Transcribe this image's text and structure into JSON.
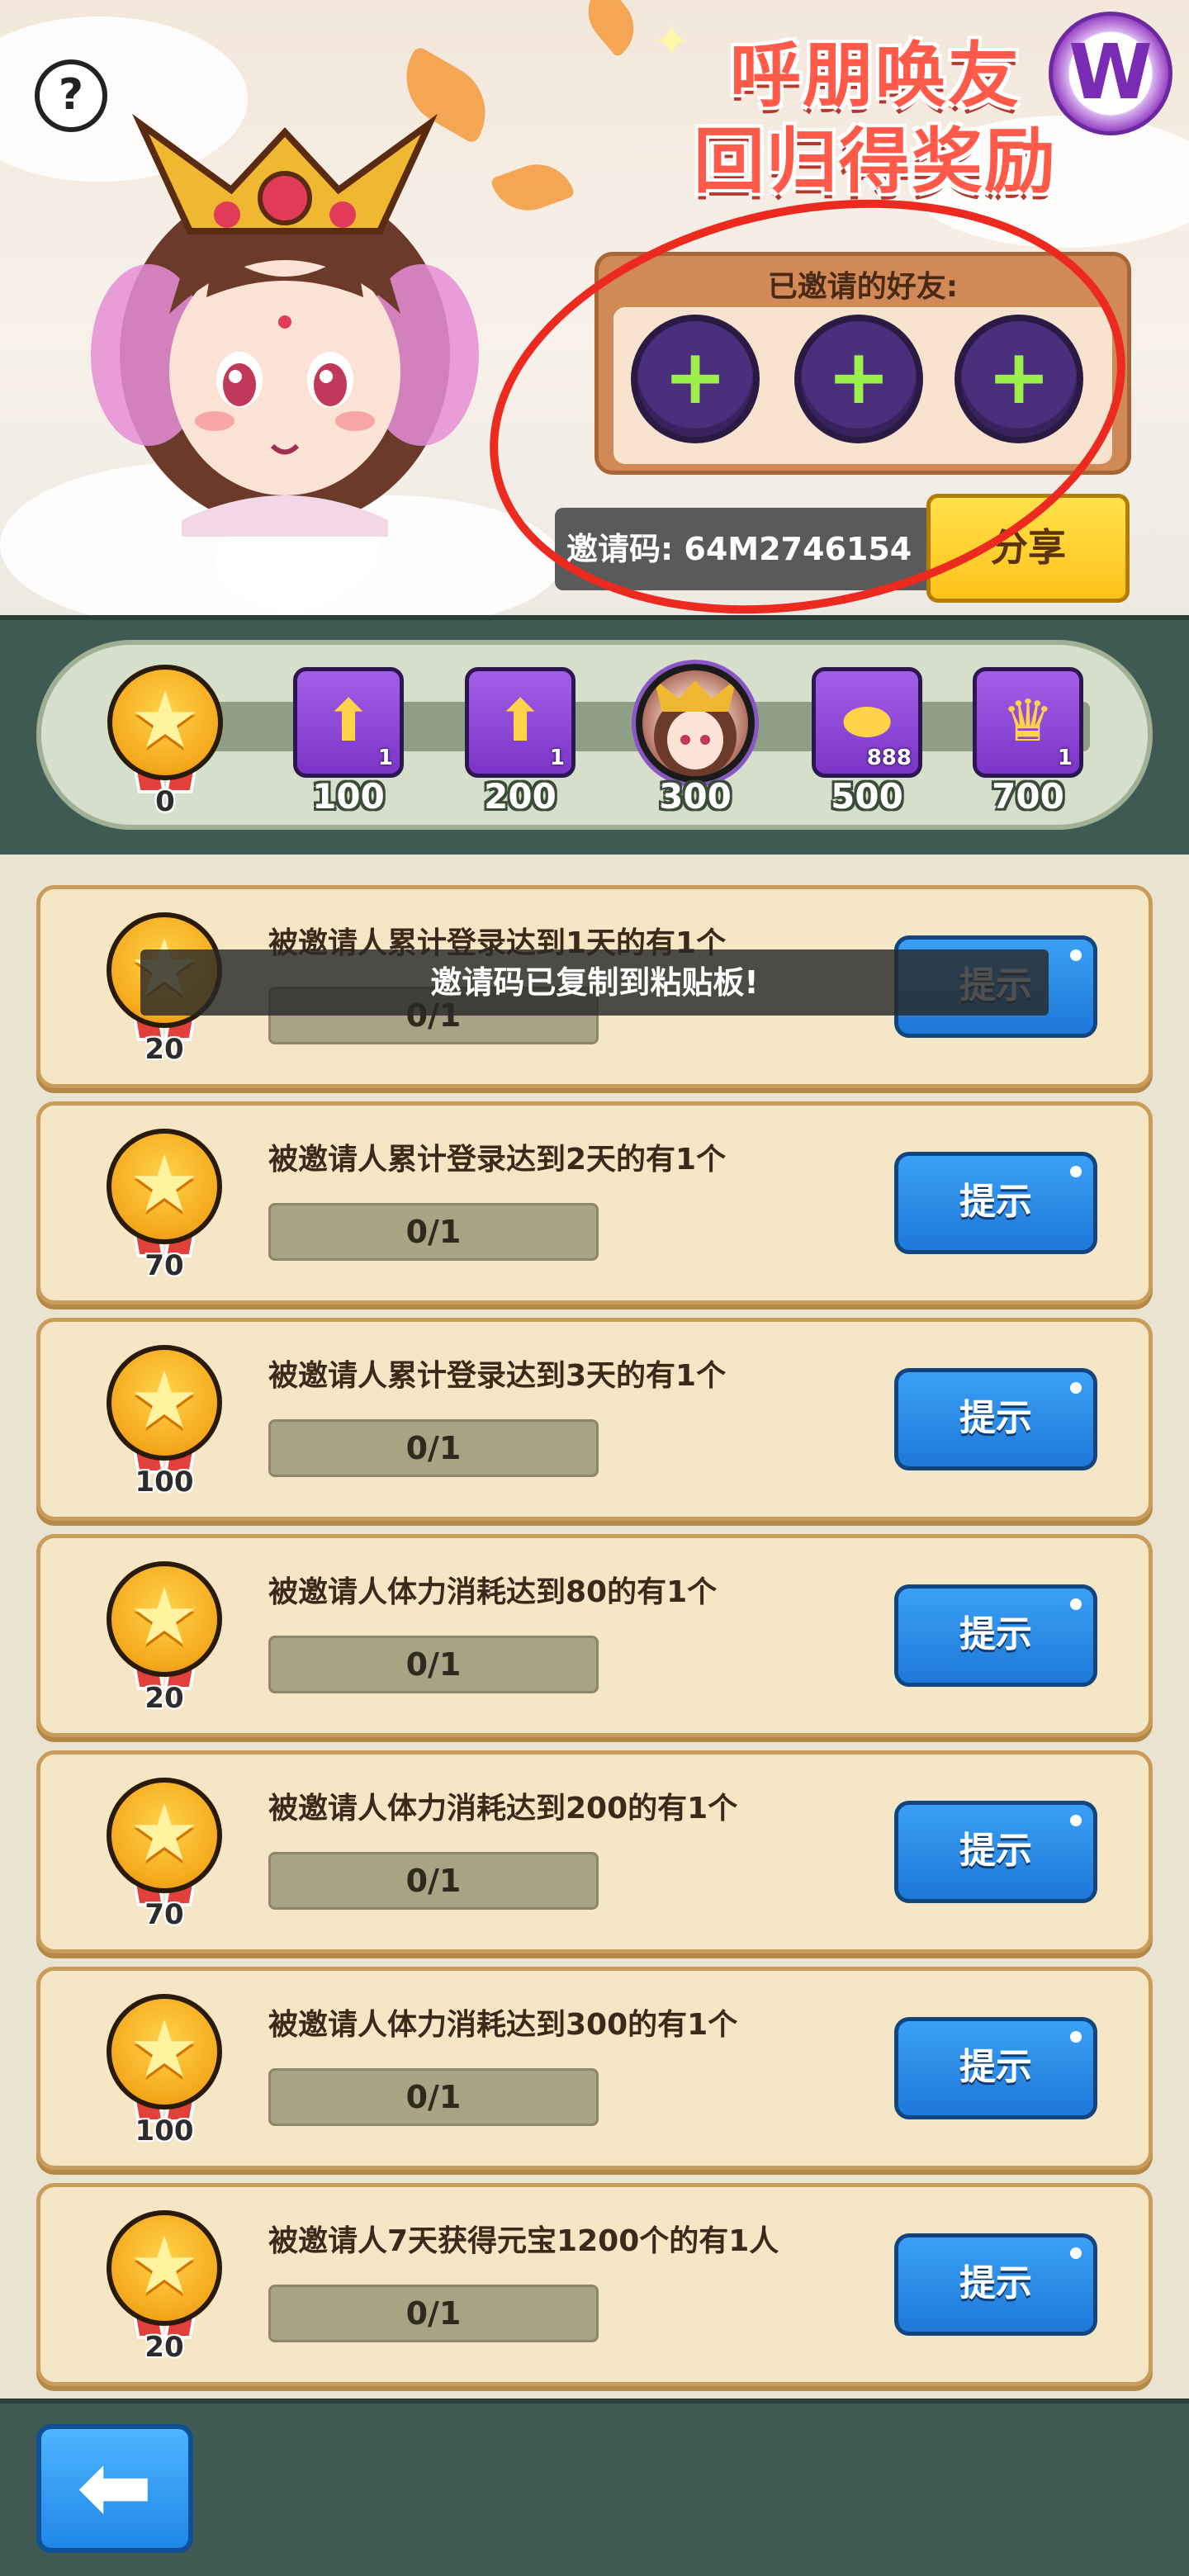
{
  "header": {
    "help_icon": "?",
    "title_line1": "呼朋唤友",
    "title_line2": "回归得奖励",
    "logo_letter": "W",
    "invited_label": "已邀请的好友:",
    "invite_slots": [
      "+",
      "+",
      "+"
    ],
    "invite_code_text": "邀请码: 64M2746154",
    "share_label": "分享"
  },
  "milestones": {
    "current_points": "0",
    "markers": [
      {
        "points": "100",
        "icon": "chest-upgrade-icon",
        "qty": "1"
      },
      {
        "points": "200",
        "icon": "chest-upgrade-icon",
        "qty": "1"
      },
      {
        "points": "300",
        "icon": "hero-avatar-icon",
        "qty": ""
      },
      {
        "points": "500",
        "icon": "gold-ingot-icon",
        "qty": "888"
      },
      {
        "points": "700",
        "icon": "crown-chest-icon",
        "qty": "1"
      }
    ]
  },
  "toast": "邀请码已复制到粘贴板!",
  "tasks": [
    {
      "reward": "20",
      "text": "被邀请人累计登录达到1天的有1个",
      "progress": "0/1",
      "button": "提示"
    },
    {
      "reward": "70",
      "text": "被邀请人累计登录达到2天的有1个",
      "progress": "0/1",
      "button": "提示"
    },
    {
      "reward": "100",
      "text": "被邀请人累计登录达到3天的有1个",
      "progress": "0/1",
      "button": "提示"
    },
    {
      "reward": "20",
      "text": "被邀请人体力消耗达到80的有1个",
      "progress": "0/1",
      "button": "提示"
    },
    {
      "reward": "70",
      "text": "被邀请人体力消耗达到200的有1个",
      "progress": "0/1",
      "button": "提示"
    },
    {
      "reward": "100",
      "text": "被邀请人体力消耗达到300的有1个",
      "progress": "0/1",
      "button": "提示"
    },
    {
      "reward": "20",
      "text": "被邀请人7天获得元宝1200个的有1人",
      "progress": "0/1",
      "button": "提示"
    }
  ],
  "footer": {
    "back_icon": "back-arrow-icon"
  },
  "colors": {
    "title_red": "#ff5a4a",
    "annotation_red": "#ec2a1f",
    "hint_blue": "#1e78d8",
    "share_yellow": "#ffc21a",
    "plus_green": "#9df04a"
  }
}
